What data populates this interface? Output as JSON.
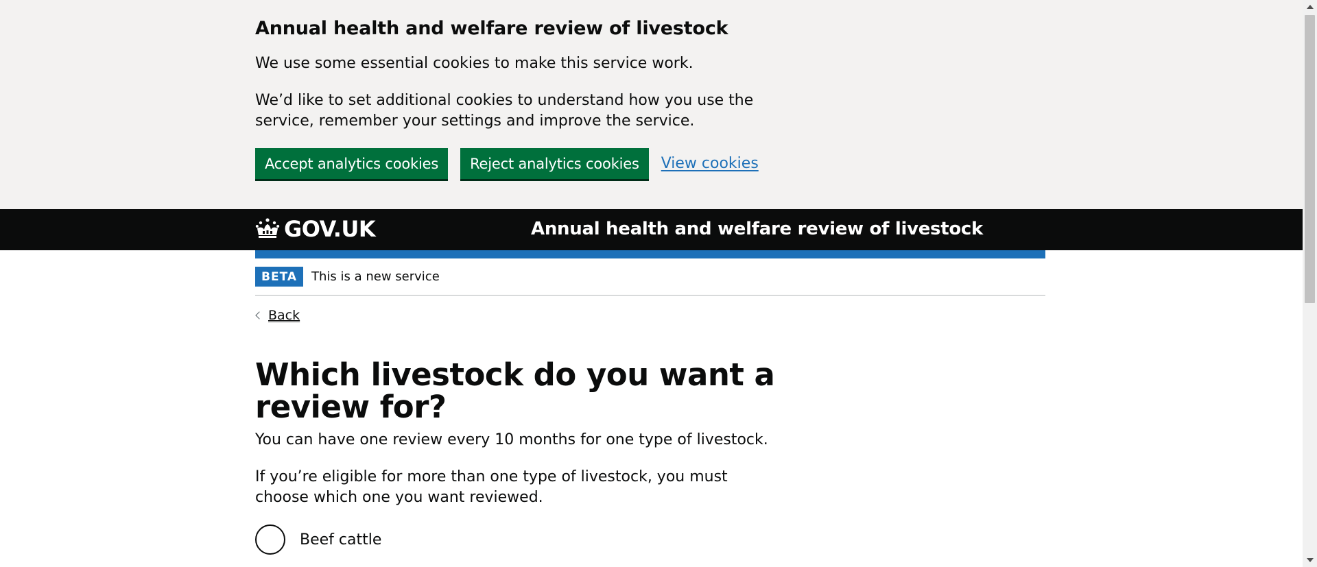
{
  "cookie_banner": {
    "heading": "Annual health and welfare review of livestock",
    "paragraph_1": "We use some essential cookies to make this service work.",
    "paragraph_2": "We’d like to set additional cookies to understand how you use the service, remember your settings and improve the service.",
    "accept_label": "Accept analytics cookies",
    "reject_label": "Reject analytics cookies",
    "view_link": "View cookies"
  },
  "header": {
    "logo_text": "GOV.UK",
    "logo_icon": "crown-icon",
    "service_name": "Annual health and welfare review of livestock"
  },
  "phase_banner": {
    "tag": "BETA",
    "text": "This is a new service"
  },
  "back_link": {
    "label": "Back",
    "icon": "chevron-left-icon"
  },
  "main": {
    "heading": "Which livestock do you want a review for?",
    "hint_1": "You can have one review every 10 months for one type of livestock.",
    "hint_2": "If you’re eligible for more than one type of livestock, you must choose which one you want reviewed.",
    "options": [
      {
        "label": "Beef cattle",
        "selected": false
      }
    ]
  },
  "colors": {
    "button_green": "#00703c",
    "link_blue": "#1d70b8",
    "header_black": "#0b0c0c",
    "banner_grey": "#f3f2f1",
    "phase_tag_blue": "#1d70b8"
  }
}
